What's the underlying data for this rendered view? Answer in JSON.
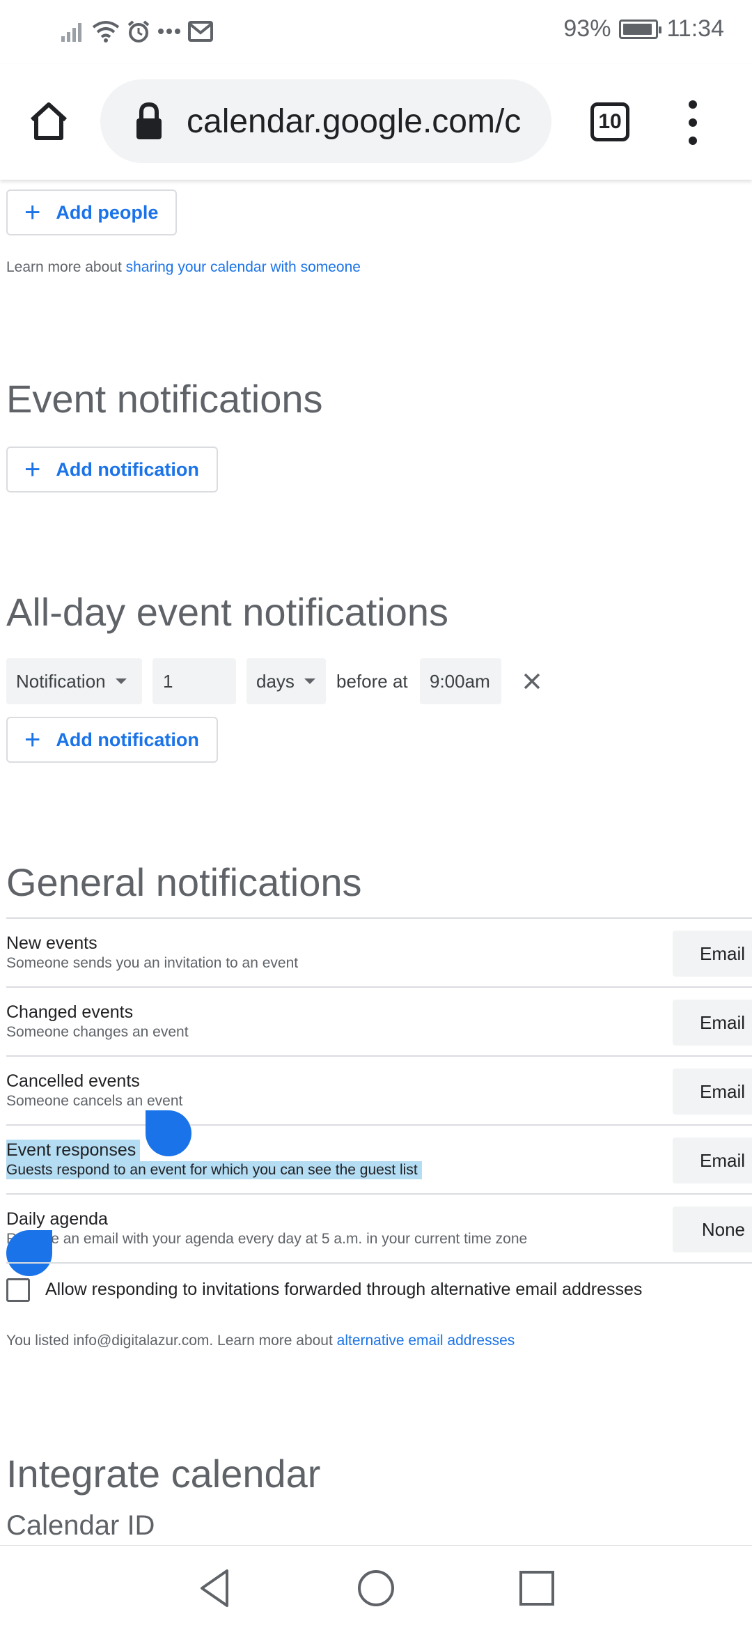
{
  "status_bar": {
    "battery_percent": "93%",
    "battery_level": 0.93,
    "time": "11:34",
    "icons": [
      "signal-icon",
      "wifi-icon",
      "alarm-icon",
      "more-notifications-icon",
      "mail-icon"
    ]
  },
  "browser": {
    "url": "calendar.google.com/c",
    "tab_count": "10",
    "icons": [
      "home-icon",
      "lock-icon",
      "tab-switcher-icon",
      "overflow-menu-icon"
    ]
  },
  "sharing": {
    "add_people_label": "Add people",
    "learn_more_prefix": "Learn more about ",
    "learn_more_link": "sharing your calendar with someone"
  },
  "event_notifications": {
    "title": "Event notifications",
    "add_notification_label": "Add notification"
  },
  "allday_notifications": {
    "title": "All-day event notifications",
    "type_value": "Notification",
    "amount_value": "1",
    "unit_value": "days",
    "before_at_label": "before at",
    "time_value": "9:00am",
    "add_notification_label": "Add notification"
  },
  "general_notifications": {
    "title": "General notifications",
    "rows": [
      {
        "title": "New events",
        "subtitle": "Someone sends you an invitation to an event",
        "value": "Email"
      },
      {
        "title": "Changed events",
        "subtitle": "Someone changes an event",
        "value": "Email"
      },
      {
        "title": "Cancelled events",
        "subtitle": "Someone cancels an event",
        "value": "Email"
      },
      {
        "title": "Event responses",
        "subtitle": "Guests respond to an event for which you can see the guest list",
        "value": "Email"
      },
      {
        "title": "Daily agenda",
        "subtitle": "Receive an email with your agenda every day at 5 a.m. in your current time zone",
        "value": "None"
      }
    ],
    "checkbox_label": "Allow responding to invitations forwarded through alternative email addresses",
    "info_prefix": "You listed info@digitalazur.com. Learn more about ",
    "info_link": "alternative email addresses"
  },
  "integrate": {
    "title": "Integrate calendar",
    "calendar_id_label": "Calendar ID"
  },
  "colors": {
    "accent": "#1a73e8",
    "selection": "#b4dcf2",
    "heading": "#5f6368"
  }
}
